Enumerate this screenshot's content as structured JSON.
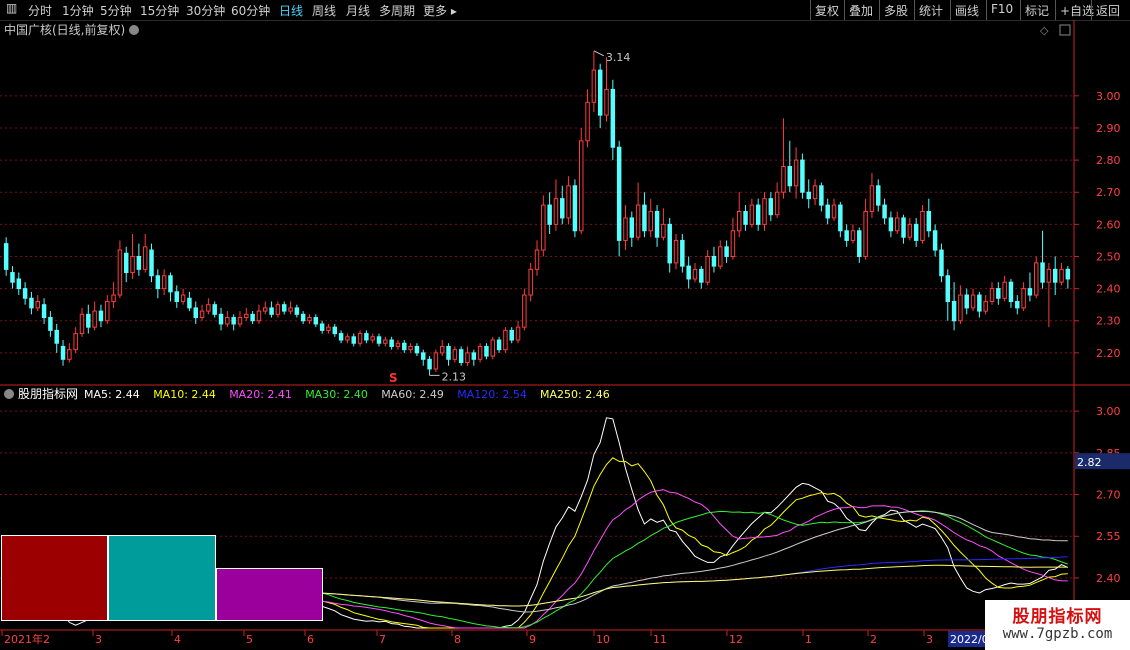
{
  "toolbar": {
    "left": [
      "分时",
      "1分钟",
      "5分钟",
      "15分钟",
      "30分钟",
      "60分钟",
      "日线",
      "周线",
      "月线",
      "多周期",
      "更多"
    ],
    "active": "日线",
    "right": [
      "复权",
      "叠加",
      "多股",
      "统计",
      "画线",
      "F10",
      "标记",
      "+自选",
      "返回"
    ]
  },
  "main_title": "中国广核(日线,前复权)",
  "watermark": {
    "cn": "股朋指标网",
    "url": "www.7gpzb.com"
  },
  "colors": {
    "up": "#ff3b3b",
    "down": "#54ffff",
    "grid": "#7a1010",
    "axis": "#cc2020",
    "ma5": "#ffffff",
    "ma10": "#ffff00",
    "ma20": "#ff4dff",
    "ma30": "#33ee33",
    "ma60": "#cccccc",
    "ma120": "#2a2aff",
    "ma250": "#ffff66",
    "box1": "#9c0000",
    "box2": "#009c9c",
    "box3": "#9c009c"
  },
  "chart_data": [
    {
      "type": "candlestick",
      "title": "中国广核(日线,前复权)",
      "ylim": [
        2.1,
        3.18
      ],
      "yticks": [
        2.2,
        2.3,
        2.4,
        2.5,
        2.6,
        2.7,
        2.8,
        2.9,
        3.0
      ],
      "annotations": [
        {
          "label": "3.14",
          "value": 3.14,
          "kind": "high"
        },
        {
          "label": "2.13",
          "value": 2.13,
          "kind": "low"
        }
      ],
      "marker": "S",
      "candles": [
        {
          "o": 2.54,
          "c": 2.46,
          "h": 2.56,
          "l": 2.44
        },
        {
          "o": 2.45,
          "c": 2.42,
          "h": 2.47,
          "l": 2.4
        },
        {
          "o": 2.43,
          "c": 2.4,
          "h": 2.45,
          "l": 2.38
        },
        {
          "o": 2.4,
          "c": 2.37,
          "h": 2.42,
          "l": 2.35
        },
        {
          "o": 2.37,
          "c": 2.34,
          "h": 2.39,
          "l": 2.32
        },
        {
          "o": 2.34,
          "c": 2.36,
          "h": 2.38,
          "l": 2.33
        },
        {
          "o": 2.35,
          "c": 2.31,
          "h": 2.37,
          "l": 2.29
        },
        {
          "o": 2.31,
          "c": 2.27,
          "h": 2.33,
          "l": 2.25
        },
        {
          "o": 2.27,
          "c": 2.23,
          "h": 2.29,
          "l": 2.2
        },
        {
          "o": 2.22,
          "c": 2.18,
          "h": 2.24,
          "l": 2.16
        },
        {
          "o": 2.18,
          "c": 2.21,
          "h": 2.23,
          "l": 2.17
        },
        {
          "o": 2.21,
          "c": 2.26,
          "h": 2.28,
          "l": 2.2
        },
        {
          "o": 2.26,
          "c": 2.32,
          "h": 2.34,
          "l": 2.25
        },
        {
          "o": 2.32,
          "c": 2.28,
          "h": 2.35,
          "l": 2.26
        },
        {
          "o": 2.28,
          "c": 2.33,
          "h": 2.36,
          "l": 2.27
        },
        {
          "o": 2.33,
          "c": 2.3,
          "h": 2.35,
          "l": 2.28
        },
        {
          "o": 2.3,
          "c": 2.36,
          "h": 2.38,
          "l": 2.29
        },
        {
          "o": 2.36,
          "c": 2.38,
          "h": 2.42,
          "l": 2.34
        },
        {
          "o": 2.38,
          "c": 2.52,
          "h": 2.55,
          "l": 2.37
        },
        {
          "o": 2.51,
          "c": 2.45,
          "h": 2.53,
          "l": 2.42
        },
        {
          "o": 2.45,
          "c": 2.5,
          "h": 2.57,
          "l": 2.43
        },
        {
          "o": 2.5,
          "c": 2.46,
          "h": 2.54,
          "l": 2.44
        },
        {
          "o": 2.46,
          "c": 2.53,
          "h": 2.57,
          "l": 2.45
        },
        {
          "o": 2.52,
          "c": 2.44,
          "h": 2.54,
          "l": 2.42
        },
        {
          "o": 2.44,
          "c": 2.4,
          "h": 2.46,
          "l": 2.37
        },
        {
          "o": 2.4,
          "c": 2.44,
          "h": 2.46,
          "l": 2.38
        },
        {
          "o": 2.44,
          "c": 2.39,
          "h": 2.45,
          "l": 2.36
        },
        {
          "o": 2.39,
          "c": 2.36,
          "h": 2.41,
          "l": 2.34
        },
        {
          "o": 2.36,
          "c": 2.38,
          "h": 2.4,
          "l": 2.35
        },
        {
          "o": 2.37,
          "c": 2.34,
          "h": 2.39,
          "l": 2.33
        },
        {
          "o": 2.34,
          "c": 2.31,
          "h": 2.36,
          "l": 2.29
        },
        {
          "o": 2.31,
          "c": 2.33,
          "h": 2.35,
          "l": 2.3
        },
        {
          "o": 2.33,
          "c": 2.35,
          "h": 2.37,
          "l": 2.32
        },
        {
          "o": 2.35,
          "c": 2.32,
          "h": 2.36,
          "l": 2.31
        },
        {
          "o": 2.32,
          "c": 2.29,
          "h": 2.34,
          "l": 2.27
        },
        {
          "o": 2.29,
          "c": 2.31,
          "h": 2.33,
          "l": 2.28
        },
        {
          "o": 2.31,
          "c": 2.29,
          "h": 2.32,
          "l": 2.27
        },
        {
          "o": 2.29,
          "c": 2.31,
          "h": 2.33,
          "l": 2.28
        },
        {
          "o": 2.31,
          "c": 2.32,
          "h": 2.34,
          "l": 2.3
        },
        {
          "o": 2.32,
          "c": 2.3,
          "h": 2.33,
          "l": 2.29
        },
        {
          "o": 2.3,
          "c": 2.33,
          "h": 2.35,
          "l": 2.29
        },
        {
          "o": 2.33,
          "c": 2.34,
          "h": 2.36,
          "l": 2.32
        },
        {
          "o": 2.34,
          "c": 2.32,
          "h": 2.36,
          "l": 2.31
        },
        {
          "o": 2.32,
          "c": 2.35,
          "h": 2.36,
          "l": 2.31
        },
        {
          "o": 2.35,
          "c": 2.33,
          "h": 2.36,
          "l": 2.32
        },
        {
          "o": 2.33,
          "c": 2.34,
          "h": 2.36,
          "l": 2.32
        },
        {
          "o": 2.34,
          "c": 2.32,
          "h": 2.35,
          "l": 2.31
        },
        {
          "o": 2.32,
          "c": 2.3,
          "h": 2.33,
          "l": 2.29
        },
        {
          "o": 2.3,
          "c": 2.31,
          "h": 2.32,
          "l": 2.29
        },
        {
          "o": 2.31,
          "c": 2.29,
          "h": 2.32,
          "l": 2.28
        },
        {
          "o": 2.29,
          "c": 2.27,
          "h": 2.3,
          "l": 2.26
        },
        {
          "o": 2.27,
          "c": 2.28,
          "h": 2.29,
          "l": 2.26
        },
        {
          "o": 2.28,
          "c": 2.26,
          "h": 2.29,
          "l": 2.25
        },
        {
          "o": 2.26,
          "c": 2.24,
          "h": 2.27,
          "l": 2.23
        },
        {
          "o": 2.24,
          "c": 2.25,
          "h": 2.26,
          "l": 2.23
        },
        {
          "o": 2.25,
          "c": 2.23,
          "h": 2.26,
          "l": 2.22
        },
        {
          "o": 2.23,
          "c": 2.26,
          "h": 2.27,
          "l": 2.22
        },
        {
          "o": 2.26,
          "c": 2.24,
          "h": 2.27,
          "l": 2.23
        },
        {
          "o": 2.24,
          "c": 2.25,
          "h": 2.26,
          "l": 2.23
        },
        {
          "o": 2.25,
          "c": 2.23,
          "h": 2.26,
          "l": 2.22
        },
        {
          "o": 2.23,
          "c": 2.24,
          "h": 2.25,
          "l": 2.22
        },
        {
          "o": 2.24,
          "c": 2.22,
          "h": 2.25,
          "l": 2.21
        },
        {
          "o": 2.22,
          "c": 2.23,
          "h": 2.24,
          "l": 2.21
        },
        {
          "o": 2.23,
          "c": 2.21,
          "h": 2.24,
          "l": 2.2
        },
        {
          "o": 2.21,
          "c": 2.22,
          "h": 2.23,
          "l": 2.2
        },
        {
          "o": 2.22,
          "c": 2.2,
          "h": 2.23,
          "l": 2.19
        },
        {
          "o": 2.2,
          "c": 2.18,
          "h": 2.21,
          "l": 2.16
        },
        {
          "o": 2.18,
          "c": 2.15,
          "h": 2.19,
          "l": 2.13
        },
        {
          "o": 2.15,
          "c": 2.2,
          "h": 2.21,
          "l": 2.14
        },
        {
          "o": 2.2,
          "c": 2.22,
          "h": 2.24,
          "l": 2.19
        },
        {
          "o": 2.22,
          "c": 2.18,
          "h": 2.23,
          "l": 2.16
        },
        {
          "o": 2.18,
          "c": 2.21,
          "h": 2.22,
          "l": 2.17
        },
        {
          "o": 2.21,
          "c": 2.17,
          "h": 2.22,
          "l": 2.16
        },
        {
          "o": 2.17,
          "c": 2.2,
          "h": 2.22,
          "l": 2.16
        },
        {
          "o": 2.2,
          "c": 2.18,
          "h": 2.21,
          "l": 2.16
        },
        {
          "o": 2.18,
          "c": 2.22,
          "h": 2.23,
          "l": 2.17
        },
        {
          "o": 2.22,
          "c": 2.19,
          "h": 2.23,
          "l": 2.18
        },
        {
          "o": 2.19,
          "c": 2.24,
          "h": 2.25,
          "l": 2.18
        },
        {
          "o": 2.24,
          "c": 2.21,
          "h": 2.25,
          "l": 2.2
        },
        {
          "o": 2.21,
          "c": 2.27,
          "h": 2.28,
          "l": 2.2
        },
        {
          "o": 2.27,
          "c": 2.24,
          "h": 2.28,
          "l": 2.23
        },
        {
          "o": 2.24,
          "c": 2.28,
          "h": 2.3,
          "l": 2.23
        },
        {
          "o": 2.28,
          "c": 2.38,
          "h": 2.4,
          "l": 2.27
        },
        {
          "o": 2.38,
          "c": 2.46,
          "h": 2.48,
          "l": 2.36
        },
        {
          "o": 2.46,
          "c": 2.52,
          "h": 2.55,
          "l": 2.44
        },
        {
          "o": 2.52,
          "c": 2.66,
          "h": 2.69,
          "l": 2.5
        },
        {
          "o": 2.66,
          "c": 2.6,
          "h": 2.7,
          "l": 2.57
        },
        {
          "o": 2.6,
          "c": 2.68,
          "h": 2.74,
          "l": 2.58
        },
        {
          "o": 2.68,
          "c": 2.62,
          "h": 2.72,
          "l": 2.6
        },
        {
          "o": 2.62,
          "c": 2.72,
          "h": 2.75,
          "l": 2.6
        },
        {
          "o": 2.72,
          "c": 2.58,
          "h": 2.74,
          "l": 2.56
        },
        {
          "o": 2.58,
          "c": 2.86,
          "h": 2.9,
          "l": 2.57
        },
        {
          "o": 2.86,
          "c": 2.98,
          "h": 3.02,
          "l": 2.84
        },
        {
          "o": 2.98,
          "c": 3.08,
          "h": 3.14,
          "l": 2.95
        },
        {
          "o": 3.08,
          "c": 2.94,
          "h": 3.1,
          "l": 2.9
        },
        {
          "o": 2.94,
          "c": 3.02,
          "h": 3.12,
          "l": 2.92
        },
        {
          "o": 3.02,
          "c": 2.84,
          "h": 3.05,
          "l": 2.8
        },
        {
          "o": 2.84,
          "c": 2.55,
          "h": 2.86,
          "l": 2.5
        },
        {
          "o": 2.55,
          "c": 2.62,
          "h": 2.66,
          "l": 2.52
        },
        {
          "o": 2.62,
          "c": 2.56,
          "h": 2.64,
          "l": 2.53
        },
        {
          "o": 2.56,
          "c": 2.66,
          "h": 2.73,
          "l": 2.55
        },
        {
          "o": 2.66,
          "c": 2.58,
          "h": 2.7,
          "l": 2.56
        },
        {
          "o": 2.58,
          "c": 2.64,
          "h": 2.68,
          "l": 2.56
        },
        {
          "o": 2.64,
          "c": 2.56,
          "h": 2.66,
          "l": 2.53
        },
        {
          "o": 2.56,
          "c": 2.6,
          "h": 2.65,
          "l": 2.55
        },
        {
          "o": 2.6,
          "c": 2.48,
          "h": 2.62,
          "l": 2.45
        },
        {
          "o": 2.48,
          "c": 2.55,
          "h": 2.57,
          "l": 2.46
        },
        {
          "o": 2.55,
          "c": 2.47,
          "h": 2.57,
          "l": 2.45
        },
        {
          "o": 2.47,
          "c": 2.43,
          "h": 2.5,
          "l": 2.4
        },
        {
          "o": 2.43,
          "c": 2.46,
          "h": 2.48,
          "l": 2.42
        },
        {
          "o": 2.46,
          "c": 2.42,
          "h": 2.47,
          "l": 2.4
        },
        {
          "o": 2.42,
          "c": 2.5,
          "h": 2.52,
          "l": 2.41
        },
        {
          "o": 2.5,
          "c": 2.47,
          "h": 2.53,
          "l": 2.45
        },
        {
          "o": 2.47,
          "c": 2.53,
          "h": 2.55,
          "l": 2.46
        },
        {
          "o": 2.53,
          "c": 2.5,
          "h": 2.55,
          "l": 2.48
        },
        {
          "o": 2.5,
          "c": 2.58,
          "h": 2.62,
          "l": 2.49
        },
        {
          "o": 2.58,
          "c": 2.64,
          "h": 2.7,
          "l": 2.56
        },
        {
          "o": 2.64,
          "c": 2.6,
          "h": 2.66,
          "l": 2.58
        },
        {
          "o": 2.6,
          "c": 2.66,
          "h": 2.68,
          "l": 2.59
        },
        {
          "o": 2.66,
          "c": 2.6,
          "h": 2.68,
          "l": 2.58
        },
        {
          "o": 2.6,
          "c": 2.68,
          "h": 2.7,
          "l": 2.58
        },
        {
          "o": 2.68,
          "c": 2.63,
          "h": 2.7,
          "l": 2.61
        },
        {
          "o": 2.63,
          "c": 2.7,
          "h": 2.73,
          "l": 2.62
        },
        {
          "o": 2.7,
          "c": 2.78,
          "h": 2.93,
          "l": 2.68
        },
        {
          "o": 2.78,
          "c": 2.72,
          "h": 2.86,
          "l": 2.7
        },
        {
          "o": 2.72,
          "c": 2.8,
          "h": 2.84,
          "l": 2.68
        },
        {
          "o": 2.8,
          "c": 2.7,
          "h": 2.82,
          "l": 2.68
        },
        {
          "o": 2.7,
          "c": 2.68,
          "h": 2.74,
          "l": 2.65
        },
        {
          "o": 2.68,
          "c": 2.72,
          "h": 2.74,
          "l": 2.66
        },
        {
          "o": 2.72,
          "c": 2.66,
          "h": 2.73,
          "l": 2.64
        },
        {
          "o": 2.66,
          "c": 2.62,
          "h": 2.68,
          "l": 2.6
        },
        {
          "o": 2.62,
          "c": 2.66,
          "h": 2.68,
          "l": 2.61
        },
        {
          "o": 2.66,
          "c": 2.58,
          "h": 2.67,
          "l": 2.56
        },
        {
          "o": 2.58,
          "c": 2.55,
          "h": 2.6,
          "l": 2.53
        },
        {
          "o": 2.55,
          "c": 2.58,
          "h": 2.6,
          "l": 2.54
        },
        {
          "o": 2.58,
          "c": 2.5,
          "h": 2.59,
          "l": 2.48
        },
        {
          "o": 2.5,
          "c": 2.64,
          "h": 2.68,
          "l": 2.49
        },
        {
          "o": 2.64,
          "c": 2.72,
          "h": 2.76,
          "l": 2.62
        },
        {
          "o": 2.72,
          "c": 2.66,
          "h": 2.74,
          "l": 2.64
        },
        {
          "o": 2.66,
          "c": 2.62,
          "h": 2.68,
          "l": 2.6
        },
        {
          "o": 2.62,
          "c": 2.58,
          "h": 2.64,
          "l": 2.56
        },
        {
          "o": 2.58,
          "c": 2.62,
          "h": 2.64,
          "l": 2.57
        },
        {
          "o": 2.62,
          "c": 2.56,
          "h": 2.63,
          "l": 2.54
        },
        {
          "o": 2.56,
          "c": 2.6,
          "h": 2.62,
          "l": 2.55
        },
        {
          "o": 2.6,
          "c": 2.55,
          "h": 2.62,
          "l": 2.53
        },
        {
          "o": 2.55,
          "c": 2.64,
          "h": 2.66,
          "l": 2.54
        },
        {
          "o": 2.64,
          "c": 2.58,
          "h": 2.68,
          "l": 2.56
        },
        {
          "o": 2.58,
          "c": 2.52,
          "h": 2.6,
          "l": 2.5
        },
        {
          "o": 2.52,
          "c": 2.44,
          "h": 2.54,
          "l": 2.42
        },
        {
          "o": 2.44,
          "c": 2.36,
          "h": 2.46,
          "l": 2.3
        },
        {
          "o": 2.36,
          "c": 2.3,
          "h": 2.42,
          "l": 2.27
        },
        {
          "o": 2.3,
          "c": 2.38,
          "h": 2.41,
          "l": 2.29
        },
        {
          "o": 2.38,
          "c": 2.34,
          "h": 2.4,
          "l": 2.32
        },
        {
          "o": 2.34,
          "c": 2.38,
          "h": 2.4,
          "l": 2.33
        },
        {
          "o": 2.38,
          "c": 2.33,
          "h": 2.39,
          "l": 2.31
        },
        {
          "o": 2.33,
          "c": 2.36,
          "h": 2.38,
          "l": 2.32
        },
        {
          "o": 2.36,
          "c": 2.4,
          "h": 2.42,
          "l": 2.35
        },
        {
          "o": 2.4,
          "c": 2.37,
          "h": 2.42,
          "l": 2.35
        },
        {
          "o": 2.37,
          "c": 2.42,
          "h": 2.44,
          "l": 2.36
        },
        {
          "o": 2.42,
          "c": 2.36,
          "h": 2.43,
          "l": 2.34
        },
        {
          "o": 2.36,
          "c": 2.34,
          "h": 2.38,
          "l": 2.32
        },
        {
          "o": 2.34,
          "c": 2.4,
          "h": 2.42,
          "l": 2.33
        },
        {
          "o": 2.4,
          "c": 2.38,
          "h": 2.45,
          "l": 2.36
        },
        {
          "o": 2.38,
          "c": 2.48,
          "h": 2.5,
          "l": 2.37
        },
        {
          "o": 2.48,
          "c": 2.42,
          "h": 2.58,
          "l": 2.4
        },
        {
          "o": 2.42,
          "c": 2.46,
          "h": 2.48,
          "l": 2.28
        },
        {
          "o": 2.46,
          "c": 2.42,
          "h": 2.5,
          "l": 2.38
        },
        {
          "o": 2.42,
          "c": 2.46,
          "h": 2.48,
          "l": 2.41
        },
        {
          "o": 2.46,
          "c": 2.43,
          "h": 2.47,
          "l": 2.4
        }
      ]
    },
    {
      "type": "line",
      "title": "股朋指标网",
      "ylim": [
        2.22,
        3.04
      ],
      "yticks": [
        2.4,
        2.55,
        2.7,
        2.85,
        3.0
      ],
      "current_marker": 2.82,
      "x_labels": [
        "2021年2",
        "3",
        "4",
        "5",
        "6",
        "7",
        "8",
        "9",
        "10",
        "11",
        "12",
        "1",
        "2",
        "3",
        "2022/0"
      ],
      "series": [
        {
          "name": "MA5",
          "value": "2.44"
        },
        {
          "name": "MA10",
          "value": "2.44"
        },
        {
          "name": "MA20",
          "value": "2.41"
        },
        {
          "name": "MA30",
          "value": "2.40"
        },
        {
          "name": "MA60",
          "value": "2.49"
        },
        {
          "name": "MA120",
          "value": "2.54"
        },
        {
          "name": "MA250",
          "value": "2.46"
        }
      ]
    }
  ]
}
